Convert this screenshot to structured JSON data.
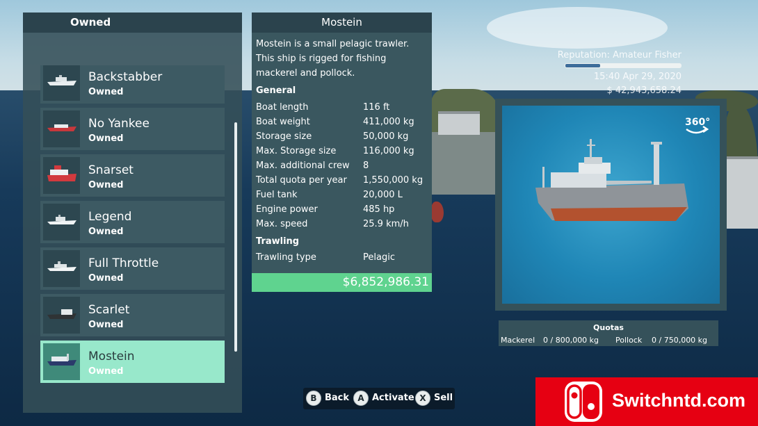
{
  "owned_panel": {
    "title": "Owned",
    "ships": [
      {
        "name": "Backstabber",
        "status": "Owned"
      },
      {
        "name": "No Yankee",
        "status": "Owned"
      },
      {
        "name": "Snarset",
        "status": "Owned"
      },
      {
        "name": "Legend",
        "status": "Owned"
      },
      {
        "name": "Full Throttle",
        "status": "Owned"
      },
      {
        "name": "Scarlet",
        "status": "Owned"
      },
      {
        "name": "Mostein",
        "status": "Owned",
        "selected": true
      }
    ]
  },
  "details": {
    "title": "Mostein",
    "description": "Mostein is a small pelagic trawler. This ship is rigged for fishing mackerel and pollock.",
    "general_title": "General",
    "general": [
      {
        "label": "Boat length",
        "value": "116 ft"
      },
      {
        "label": "Boat weight",
        "value": "411,000 kg"
      },
      {
        "label": "Storage size",
        "value": "50,000 kg"
      },
      {
        "label": "Max. Storage size",
        "value": "116,000 kg"
      },
      {
        "label": "Max. additional crew",
        "value": "8"
      },
      {
        "label": "Total quota per year",
        "value": "1,550,000 kg"
      },
      {
        "label": "Fuel tank",
        "value": "20,000 L"
      },
      {
        "label": "Engine power",
        "value": "485 hp"
      },
      {
        "label": "Max. speed",
        "value": "25.9 km/h"
      }
    ],
    "trawling_title": "Trawling",
    "trawling": [
      {
        "label": "Trawling type",
        "value": "Pelagic"
      }
    ],
    "price": "$6,852,986.31"
  },
  "hud": {
    "reputation": "Reputation: Amateur Fisher",
    "reputation_progress": 0.3,
    "time": "15:40 Apr 29, 2020",
    "money": "$ 42,943,658.24"
  },
  "preview": {
    "rotate_label": "360°"
  },
  "quotas": {
    "title": "Quotas",
    "items": [
      {
        "species": "Mackerel",
        "value": "0 / 800,000 kg"
      },
      {
        "species": "Pollock",
        "value": "0 / 750,000 kg"
      }
    ]
  },
  "controls": [
    {
      "button": "B",
      "label": "Back"
    },
    {
      "button": "A",
      "label": "Activate"
    },
    {
      "button": "X",
      "label": "Sell"
    }
  ],
  "watermark": {
    "text": "Switchntd.com"
  },
  "colors": {
    "accent_green": "#5fd38f",
    "selected_item": "#98e8cb",
    "watermark_red": "#e60012"
  }
}
